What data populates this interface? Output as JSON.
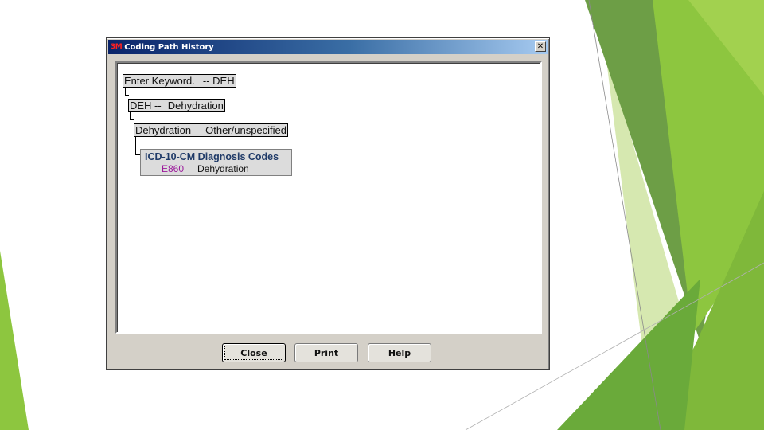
{
  "window": {
    "logo": "3M",
    "title": "Coding Path History",
    "close_glyph": "✕"
  },
  "path": [
    {
      "label": "Enter Keyword.",
      "value": "-- DEH"
    },
    {
      "label": "DEH --",
      "value": "Dehydration"
    },
    {
      "label": "Dehydration",
      "value": "Other/unspecified"
    }
  ],
  "result": {
    "heading": "ICD-10-CM Diagnosis Codes",
    "code": "E860",
    "description": "Dehydration"
  },
  "buttons": {
    "close": "Close",
    "print": "Print",
    "help": "Help"
  },
  "colors": {
    "titlebar_start": "#0a246a",
    "titlebar_end": "#a6caf0",
    "code_color": "#9b1a9b",
    "heading_color": "#1f3a68",
    "deco_green": "#8dc63f"
  }
}
